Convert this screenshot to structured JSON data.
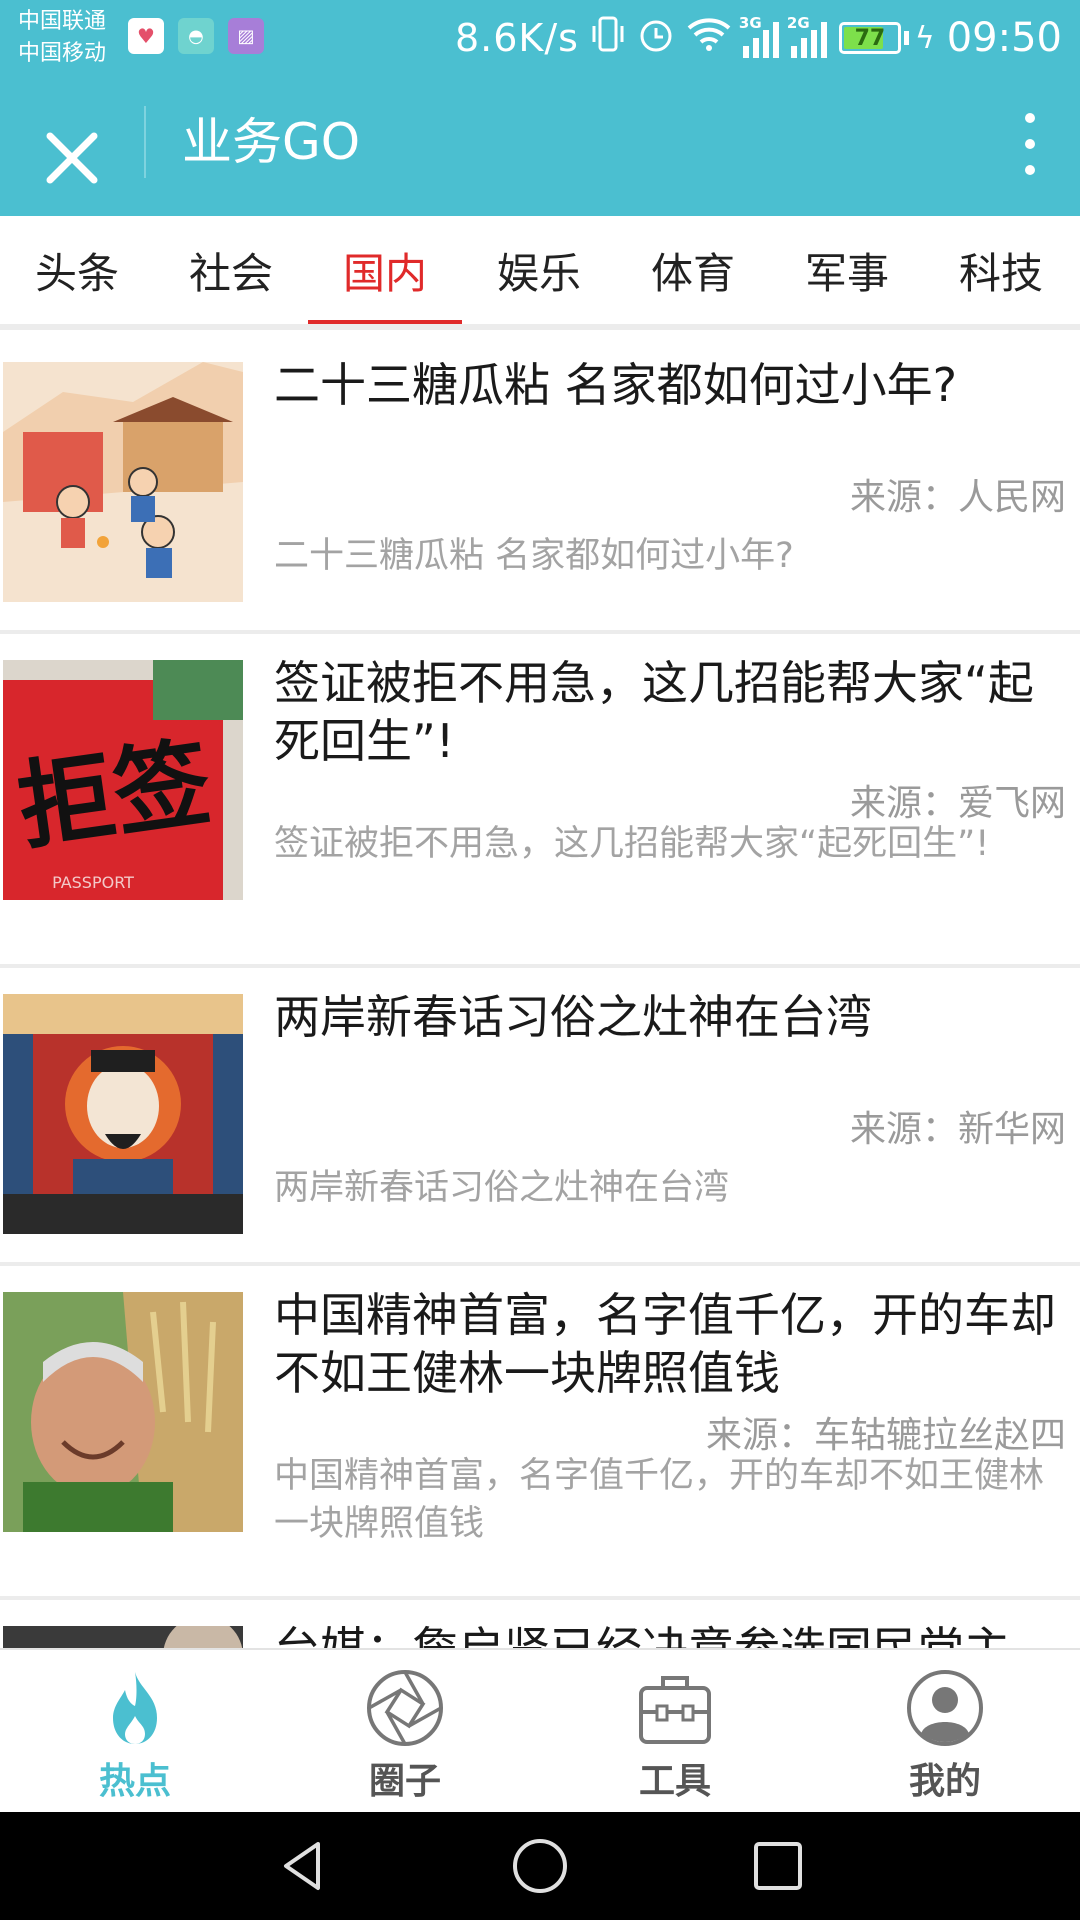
{
  "status_bar": {
    "carrier_1": "中国联通",
    "carrier_2": "中国移动",
    "net_speed": "8.6K/s",
    "signal_1_tag": "3G",
    "signal_2_tag": "2G",
    "battery_level": "77",
    "battery_percent": 77,
    "time": "09:50",
    "notification_icons": [
      "health-icon",
      "android-icon",
      "gallery-icon"
    ]
  },
  "header": {
    "title": "业务GO",
    "close_icon": "close-icon",
    "more_icon": "more-vertical-icon"
  },
  "tabs": [
    {
      "label": "头条",
      "active": false
    },
    {
      "label": "社会",
      "active": false
    },
    {
      "label": "国内",
      "active": true
    },
    {
      "label": "娱乐",
      "active": false
    },
    {
      "label": "体育",
      "active": false
    },
    {
      "label": "军事",
      "active": false
    },
    {
      "label": "科技",
      "active": false
    }
  ],
  "news": [
    {
      "title": "二十三糖瓜粘 名家都如何过小年?",
      "source": "来源：人民网",
      "summary": "二十三糖瓜粘 名家都如何过小年?"
    },
    {
      "title": "签证被拒不用急，这几招能帮大家“起死回生”!",
      "source": "来源：爱飞网",
      "summary": "签证被拒不用急，这几招能帮大家“起死回生”!",
      "thumb_text": "拒签",
      "thumb_subtext": "PASSPORT"
    },
    {
      "title": "两岸新春话习俗之灶神在台湾",
      "source": "来源：新华网",
      "summary": "两岸新春话习俗之灶神在台湾"
    },
    {
      "title": "中国精神首富，名字值千亿，开的车却不如王健林一块牌照值钱",
      "source": "来源：车轱辘拉丝赵四",
      "summary": "中国精神首富，名字值千亿，开的车却不如王健林一块牌照值钱"
    },
    {
      "title": "台媒：詹启贤已经决意参选国民党主"
    }
  ],
  "bottom_nav": [
    {
      "label": "热点",
      "icon": "flame-icon",
      "active": true
    },
    {
      "label": "圈子",
      "icon": "aperture-icon",
      "active": false
    },
    {
      "label": "工具",
      "icon": "toolbox-icon",
      "active": false
    },
    {
      "label": "我的",
      "icon": "user-icon",
      "active": false
    }
  ],
  "colors": {
    "primary": "#4bbfd0",
    "tab_active": "#e02a2a",
    "source_text": "#9a9a9a",
    "summary_text": "#a3a3a3"
  }
}
